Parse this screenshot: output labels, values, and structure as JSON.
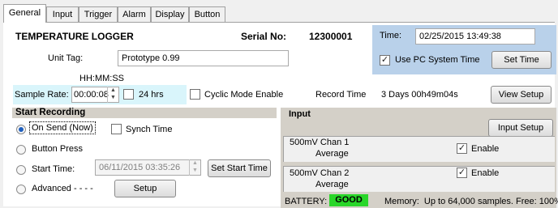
{
  "tabs": [
    "General",
    "Input",
    "Trigger",
    "Alarm",
    "Display",
    "Button"
  ],
  "header": {
    "title": "TEMPERATURE LOGGER",
    "serial_label": "Serial No:",
    "serial_value": "12300001"
  },
  "time_panel": {
    "label": "Time:",
    "value": "02/25/2015 13:49:38",
    "use_pc_label": "Use PC System Time",
    "use_pc_checked": true,
    "set_button": "Set Time"
  },
  "unit_tag": {
    "label": "Unit Tag:",
    "value": "Prototype 0.99"
  },
  "sample": {
    "format_hint": "HH:MM:SS",
    "label": "Sample Rate:",
    "value": "00:00:08",
    "hrs24_label": "24 hrs",
    "cyclic_label": "Cyclic Mode Enable",
    "record_time_label": "Record Time",
    "record_time_value": "3 Days 00h49m04s",
    "view_setup_button": "View Setup"
  },
  "start_recording": {
    "title": "Start Recording",
    "on_send_label": "On Send (Now)",
    "synch_label": "Synch Time",
    "button_press_label": "Button Press",
    "start_time_label": "Start Time:",
    "start_time_value": "06/11/2015 03:35:26",
    "set_start_button": "Set Start Time",
    "advanced_label": "Advanced - - - -",
    "setup_button": "Setup"
  },
  "input_panel": {
    "title": "Input",
    "setup_button": "Input Setup",
    "channels": [
      {
        "name": "500mV Chan 1",
        "mode": "Average",
        "enable_label": "Enable",
        "enabled": true
      },
      {
        "name": "500mV Chan 2",
        "mode": "Average",
        "enable_label": "Enable",
        "enabled": true
      }
    ]
  },
  "status": {
    "battery_label": "BATTERY:",
    "battery_value": "GOOD",
    "memory_text": "Memory:  Up to 64,000 samples. Free: 100%"
  },
  "colors": {
    "time_panel_bg": "#b9d1ea",
    "sample_highlight": "#d9f5fb",
    "battery_good": "#29d629",
    "section_gray": "#d4d0c8"
  }
}
